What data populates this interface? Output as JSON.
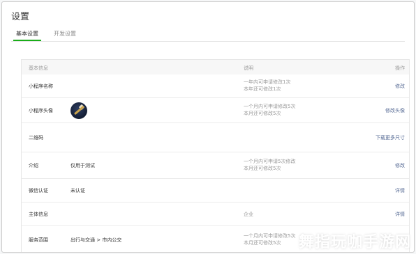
{
  "page": {
    "title": "设置"
  },
  "tabs": [
    {
      "label": "基本设置",
      "active": true
    },
    {
      "label": "开发设置",
      "active": false
    }
  ],
  "table": {
    "headers": {
      "info": "基本信息",
      "desc": "说明",
      "op": "操作"
    },
    "rows": [
      {
        "label": "小程序名称",
        "value": "",
        "desc": [
          "一年内可申请修改1次",
          "本年还可修改1次"
        ],
        "op": "修改"
      },
      {
        "label": "小程序头像",
        "value": "",
        "desc": [
          "一个月内可申请修改5次",
          "本月还可修改5次"
        ],
        "op": "修改头像"
      },
      {
        "label": "二维码",
        "value": "",
        "desc": [],
        "op": "下载更多尺寸"
      },
      {
        "label": "介绍",
        "value": "仅用于测试",
        "desc": [
          "一个月内可申请5次修改",
          "本月还可修改5次"
        ],
        "op": "修改"
      },
      {
        "label": "微信认证",
        "value": "未认证",
        "desc": [],
        "op": "详情"
      },
      {
        "label": "主体信息",
        "value": "",
        "desc": [
          "企业"
        ],
        "op": "详情"
      },
      {
        "label": "服务范围",
        "value": "出行与交通 > 市内公交",
        "desc": [
          "一个月内可申请修改5次",
          "本月还可修改5次"
        ],
        "op": ""
      }
    ]
  },
  "watermark": "舞指玩咖手游网",
  "colors": {
    "accent": "#1aad19",
    "link": "#576b95",
    "muted": "#9a9a9a"
  }
}
